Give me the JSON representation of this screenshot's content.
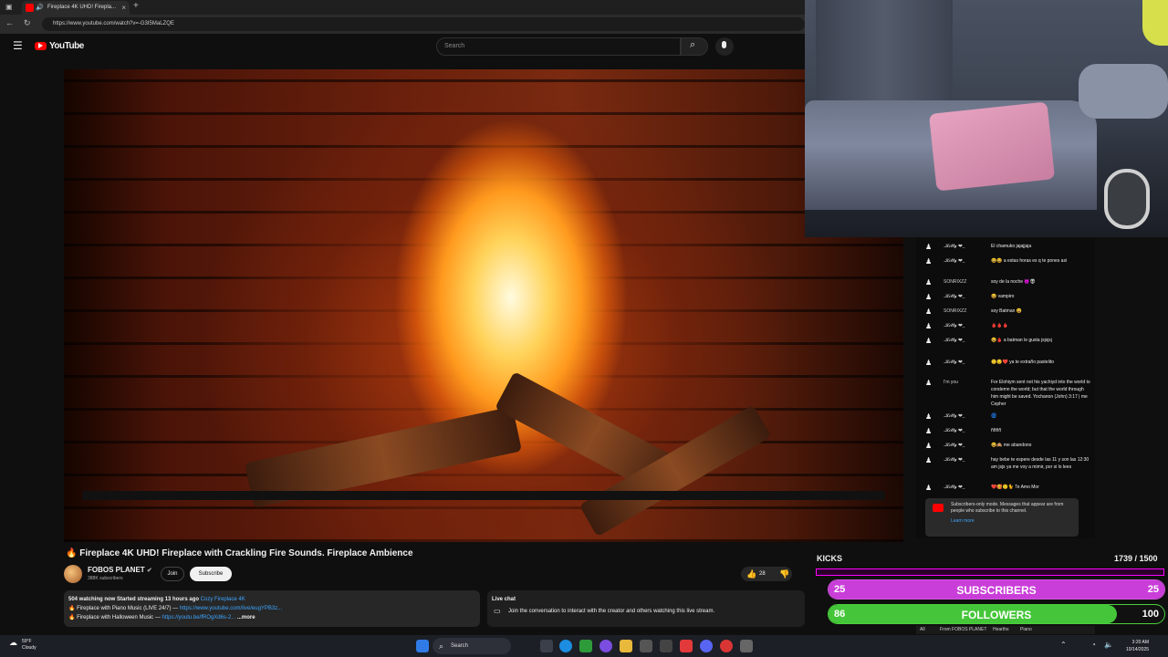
{
  "browser": {
    "tab_title": "Fireplace 4K UHD! Firepla...",
    "url": "https://www.youtube.com/watch?v=-G3I5MaLZQE",
    "close_glyph": "×",
    "newtab_glyph": "+"
  },
  "youtube": {
    "logo_text": "YouTube",
    "search_placeholder": "Search"
  },
  "video": {
    "title": "🔥 Fireplace 4K UHD! Fireplace with Crackling Fire Sounds. Fireplace Ambience",
    "channel": "FOBOS PLANET",
    "subscribers": "388K subscribers",
    "join_label": "Join",
    "subscribe_label": "Subscribe",
    "likes": "28",
    "description": {
      "meta": "504 watching now  Started streaming 13 hours ago",
      "tag": "Cozy Fireplace 4K",
      "line1_text": "🔥 Fireplace with Piano Music (LIVE 24/7) —",
      "line1_link": "https://www.youtube.com/live/eugYPB3z...",
      "line2_text": "🔥 Fireplace with Halloween Music —",
      "line2_link": "https://youtu.be/fROgXd6s-2...",
      "more": "...more"
    },
    "livechat": {
      "title": "Live chat",
      "prompt": "Join the conversation to interact with the creator and others watching this live stream."
    }
  },
  "chat": {
    "messages": [
      {
        "user": ".𝓚𝓲𝓽𝓽𝔂 ❤_",
        "text": "El chamuko jajajjaja"
      },
      {
        "user": ".𝓚𝓲𝓽𝓽𝔂 ❤_",
        "text": "😆😆 a estas horas es q te pones asi"
      },
      {
        "user": "SONRIXZZ",
        "text": "soy de la noche 😈👽"
      },
      {
        "user": ".𝓚𝓲𝓽𝓽𝔂 ❤_",
        "text": "😆 vampiro"
      },
      {
        "user": "SONRIXZZ",
        "text": "soy Batman 😆"
      },
      {
        "user": ".𝓚𝓲𝓽𝓽𝔂 ❤_",
        "text": "🩸🩸🩸"
      },
      {
        "user": ".𝓚𝓲𝓽𝓽𝔂 ❤_",
        "text": "😆🩸 a batman le gusta jsjsjsj"
      },
      {
        "user": ".𝓚𝓲𝓽𝓽𝔂 ❤_",
        "text": "🙂😌❤️ ya te extraño pastelito"
      },
      {
        "user": "I'm you",
        "text": "For Elohiym sent not his yachiyd into the world to condemn the world; but that the world through him might be saved. Yochanon (John) 3:17 | me Cepher"
      },
      {
        "user": ".𝓚𝓲𝓽𝓽𝔂 ❤_",
        "text": "🌀"
      },
      {
        "user": ".𝓚𝓲𝓽𝓽𝔂 ❤_",
        "text": "ññññ"
      },
      {
        "user": ".𝓚𝓲𝓽𝓽𝔂 ❤_",
        "text": "😆🙈 me abandono"
      },
      {
        "user": ".𝓚𝓲𝓽𝓽𝔂 ❤_",
        "text": "hay bebe te espere desde las 11 y son las 12:30 am jsjs ya me voy a mimir, por si lo lees"
      },
      {
        "user": ".𝓚𝓲𝓽𝓽𝔂 ❤_",
        "text": "❤️🥰🙂🐈 Te Amo Mor"
      }
    ],
    "notice": "Subscribers-only mode. Messages that appear are from people who subscribe to this channel.",
    "learn_more": "Learn more",
    "strip": [
      "All",
      "From FOBOS PLANET",
      "Hearths",
      "Piano"
    ]
  },
  "overlay": {
    "kicks_label": "KICKS",
    "kicks_count": "1739 / 1500",
    "subs_left": "25",
    "subs_label": "SUBSCRIBERS",
    "subs_right": "25",
    "subs_fraction": 1.0,
    "followers_left": "86",
    "followers_label": "FOLLOWERS",
    "followers_right": "100",
    "followers_fraction": 0.86,
    "subs_color": "#c93ed8",
    "followers_color": "#45c63a"
  },
  "taskbar": {
    "weather_temp": "59°F",
    "weather_desc": "Cloudy",
    "search_label": "Search",
    "time": "3:20 AM",
    "date": "10/14/2025"
  }
}
